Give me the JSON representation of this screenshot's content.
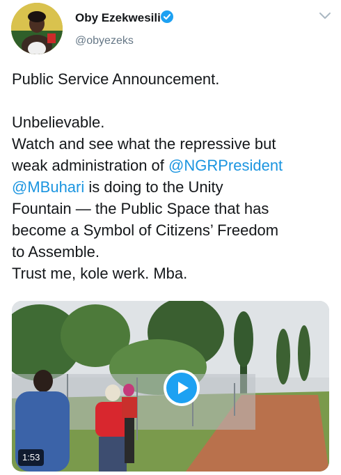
{
  "author": {
    "display_name": "Oby Ezekwesili",
    "handle": "@obyezeks",
    "verified": true
  },
  "tweet": {
    "lines": [
      [
        {
          "text": "Public Service Announcement."
        }
      ],
      [],
      [
        {
          "text": "Unbelievable."
        }
      ],
      [
        {
          "text": "Watch and see what the repressive but"
        }
      ],
      [
        {
          "text": "weak administration of "
        },
        {
          "text": "@NGRPresident",
          "link": true
        }
      ],
      [
        {
          "text": "@MBuhari",
          "link": true
        },
        {
          "text": " is doing to the Unity"
        }
      ],
      [
        {
          "text": "Fountain — the Public Space that has"
        }
      ],
      [
        {
          "text": "become a Symbol of Citizens’ Freedom"
        }
      ],
      [
        {
          "text": "to Assemble."
        }
      ],
      [
        {
          "text": "Trust me, kole werk. Mba."
        }
      ]
    ]
  },
  "media": {
    "type": "video",
    "duration": "1:53"
  },
  "icons": {
    "verified": "verified-badge-icon",
    "menu": "chevron-down-icon",
    "play": "play-icon"
  },
  "colors": {
    "link": "#1b95e0",
    "accent": "#1da1f2",
    "secondary_text": "#657786"
  }
}
